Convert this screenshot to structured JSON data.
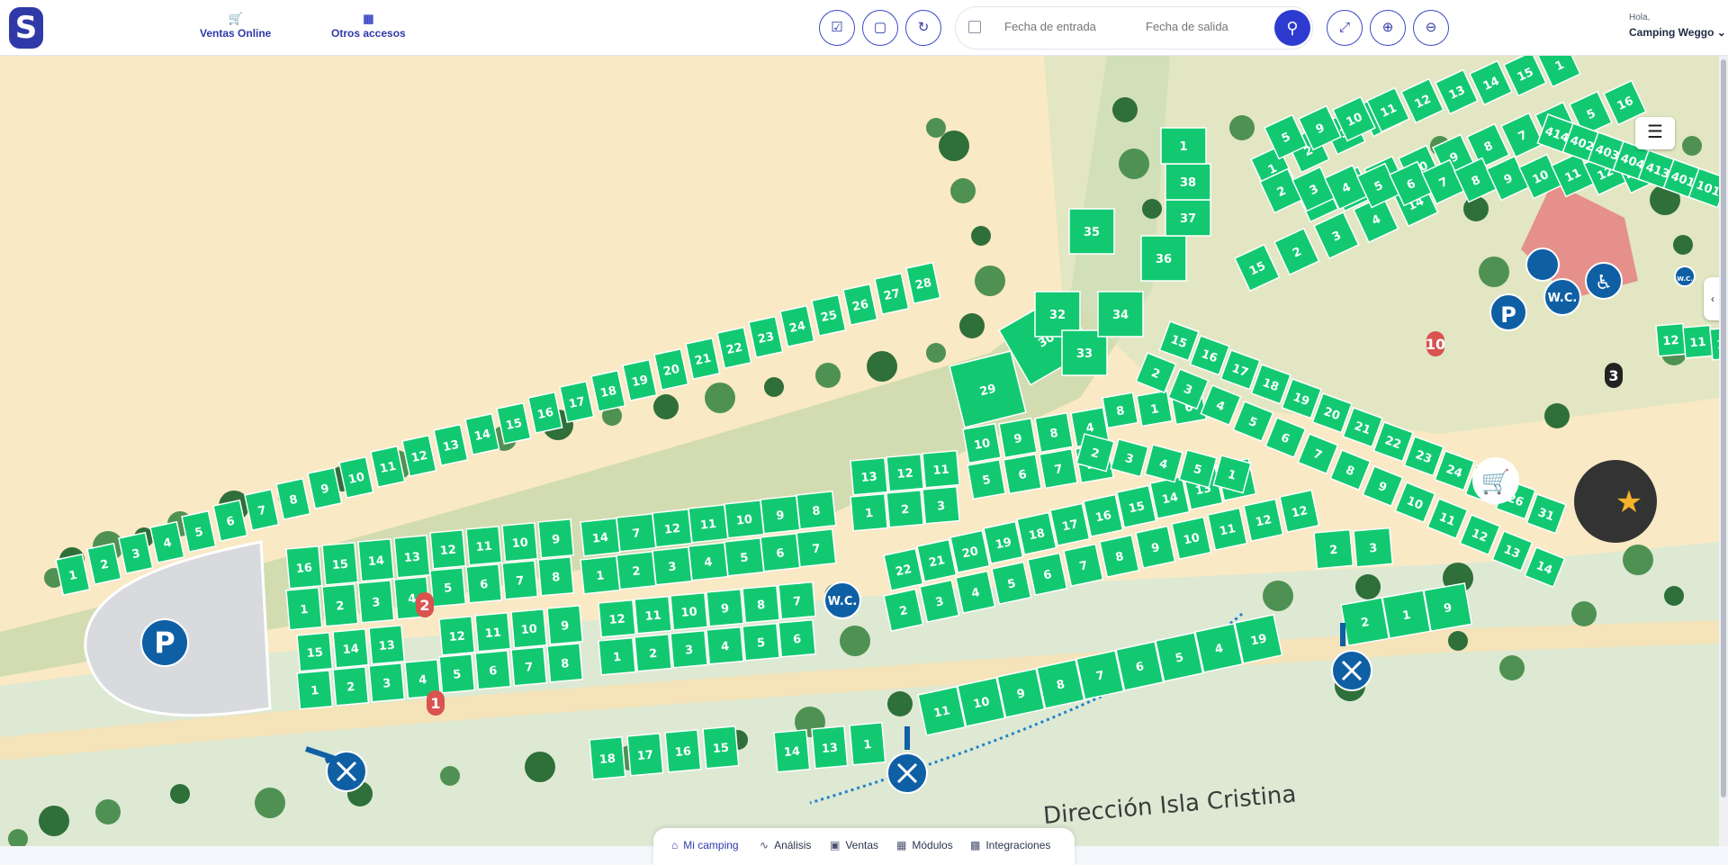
{
  "header": {
    "logo_letter": "S",
    "nav": [
      {
        "label": "Ventas Online",
        "icon": "cart-icon"
      },
      {
        "label": "Otros accesos",
        "icon": "grid-icon"
      }
    ],
    "tool_buttons": [
      {
        "icon": "calendar-check-icon"
      },
      {
        "icon": "map-icon"
      },
      {
        "icon": "refresh-icon"
      }
    ],
    "search": {
      "checkin_placeholder": "Fecha de entrada",
      "checkout_placeholder": "Fecha de salida"
    },
    "view_buttons": [
      {
        "icon": "fullscreen-icon"
      },
      {
        "icon": "zoom-in-icon"
      },
      {
        "icon": "zoom-out-icon"
      }
    ],
    "greeting": "Hola,",
    "account": "Camping Weggo"
  },
  "map": {
    "road_label": "Dirección Isla Cristina",
    "section_markers": [
      "1",
      "2",
      "10",
      "3"
    ],
    "amenities": [
      "W.C.",
      "W.C.",
      "W.C.",
      "P",
      "P"
    ],
    "plots": [
      "16",
      "15",
      "14",
      "13",
      "1",
      "2",
      "3",
      "4",
      "12",
      "11",
      "10",
      "9",
      "5",
      "6",
      "7",
      "8",
      "15",
      "14",
      "13",
      "1",
      "2",
      "3",
      "4",
      "12",
      "11",
      "10",
      "9",
      "5",
      "6",
      "7",
      "8",
      "14",
      "7",
      "12",
      "11",
      "10",
      "9",
      "8",
      "1",
      "2",
      "3",
      "4",
      "5",
      "6",
      "7",
      "12",
      "11",
      "10",
      "9",
      "8",
      "7",
      "1",
      "2",
      "3",
      "4",
      "5",
      "6",
      "1",
      "2",
      "3",
      "4",
      "5",
      "6",
      "7",
      "8",
      "9",
      "10",
      "11",
      "12",
      "13",
      "14",
      "15",
      "16",
      "17",
      "18",
      "19",
      "20",
      "21",
      "22",
      "23",
      "24",
      "25",
      "26",
      "27",
      "28",
      "29",
      "30",
      "13",
      "12",
      "11",
      "1",
      "2",
      "3",
      "10",
      "9",
      "8",
      "4",
      "5",
      "6",
      "7",
      "23",
      "22",
      "21",
      "20",
      "19",
      "18",
      "17",
      "16",
      "15",
      "14",
      "13",
      "1",
      "2",
      "3",
      "4",
      "5",
      "6",
      "7",
      "8",
      "9",
      "10",
      "11",
      "12",
      "12",
      "11",
      "10",
      "9",
      "8",
      "7",
      "6",
      "5",
      "4",
      "19",
      "18",
      "17",
      "16",
      "15",
      "14",
      "13",
      "1",
      "2",
      "3",
      "2",
      "1",
      "9",
      "8",
      "1",
      "6",
      "2",
      "3",
      "4",
      "5",
      "1",
      "2",
      "3",
      "4",
      "5",
      "6",
      "7",
      "8",
      "9",
      "10",
      "11",
      "12",
      "13",
      "14",
      "15",
      "16",
      "17",
      "18",
      "19",
      "20",
      "21",
      "22",
      "23",
      "24",
      "25",
      "26",
      "31",
      "32",
      "33",
      "34",
      "35",
      "36",
      "37",
      "38",
      "1",
      "15",
      "2",
      "3",
      "4",
      "14",
      "13",
      "12",
      "11",
      "10",
      "9",
      "8",
      "7",
      "6",
      "5",
      "16",
      "1",
      "2",
      "3",
      "4",
      "5",
      "9",
      "10",
      "11",
      "12",
      "13",
      "14",
      "15",
      "1",
      "2",
      "3",
      "4",
      "5",
      "6",
      "7",
      "8",
      "9",
      "10",
      "11",
      "12",
      "412",
      "414",
      "402",
      "403",
      "404",
      "413",
      "401",
      "101",
      "12",
      "11",
      "10",
      "9",
      "1"
    ]
  },
  "bottom_nav": [
    {
      "label": "Mi camping",
      "icon": "home-icon",
      "active": true
    },
    {
      "label": "Análisis",
      "icon": "activity-icon",
      "active": false
    },
    {
      "label": "Ventas",
      "icon": "calendar-icon",
      "active": false
    },
    {
      "label": "Módulos",
      "icon": "modules-icon",
      "active": false
    },
    {
      "label": "Integraciones",
      "icon": "integrations-icon",
      "active": false
    }
  ]
}
